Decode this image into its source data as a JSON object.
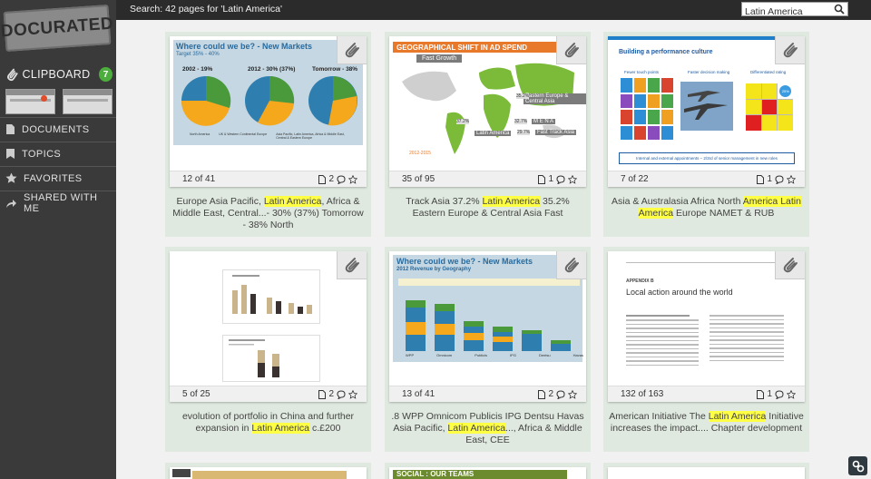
{
  "app": {
    "logo_text": "DOCURATED"
  },
  "sidebar": {
    "clipboard_label": "CLIPBOARD",
    "clipboard_count": "7",
    "items": [
      {
        "label": "DOCUMENTS",
        "icon": "documents-icon"
      },
      {
        "label": "TOPICS",
        "icon": "topics-icon"
      },
      {
        "label": "FAVORITES",
        "icon": "star-icon"
      },
      {
        "label": "SHARED WITH ME",
        "icon": "share-icon"
      }
    ]
  },
  "header": {
    "search_summary": "Search: 42 pages for 'Latin America'",
    "search_value": "Latin America"
  },
  "results": [
    {
      "page": "12 of 41",
      "pages_count": "2",
      "comments": "",
      "caption_parts": [
        "Europe Asia Pacific, ",
        "Latin America",
        ", Africa & Middle East, Central...- 30% (37%) Tomorrow - 38% North"
      ],
      "thumb": {
        "title": "Where could we be? - New Markets",
        "subtitle": "Target 35% - 40%",
        "labels": [
          "2002 - 19%",
          "2012 - 30% (37%)",
          "Tomorrow - 38%"
        ],
        "legend": [
          "North America",
          "UK & Western Continental Europe",
          "Asia Pacific, Latin America, Africa & Middle East, Central & Eastern Europe"
        ]
      }
    },
    {
      "page": "35 of 95",
      "pages_count": "1",
      "comments": "",
      "caption_parts": [
        "Track Asia 37.2% ",
        "Latin America",
        " 35.2% Eastern Europe & Central Asia Fast"
      ],
      "thumb": {
        "title": "GEOGRAPHICAL SHIFT IN AD SPEND",
        "tag": "Fast Growth",
        "labels": [
          "Latin America",
          "Eastern Europe & Central Asia",
          "M E N A",
          "Fast Track Asia"
        ],
        "values": [
          "37.2%",
          "35.2%",
          "32.7%",
          "29.7%"
        ],
        "footer": "2012-2015"
      }
    },
    {
      "page": "7 of 22",
      "pages_count": "1",
      "comments": "",
      "caption_parts": [
        "Asia & Australasia Africa North ",
        "America Latin America",
        " Europe NAMET & RUB"
      ],
      "thumb": {
        "title": "Building a performance culture",
        "cols": [
          "Fewer touch points",
          "Faster decision making",
          "Differentiated rating"
        ],
        "footer": "Internal and external appointments – 2/3rd of senior management in new roles",
        "pct": "25%"
      }
    },
    {
      "page": "5 of 25",
      "pages_count": "2",
      "comments": "",
      "caption_parts": [
        "evolution of portfolio in China and further expansion in ",
        "Latin America",
        " c.£200"
      ],
      "thumb": {}
    },
    {
      "page": "13 of 41",
      "pages_count": "2",
      "comments": "",
      "caption_parts": [
        ".8 WPP Omnicom Publicis IPG Dentsu Havas Asia Pacific, ",
        "Latin America",
        "..., Africa & Middle East, CEE"
      ],
      "thumb": {
        "title": "Where could we be? - New Markets",
        "subtitle": "2012 Revenue by Geography",
        "bars": [
          "WPP",
          "Omnicom",
          "Publicis",
          "IPG",
          "Dentsu",
          "Havas"
        ]
      }
    },
    {
      "page": "132 of 163",
      "pages_count": "1",
      "comments": "",
      "caption_parts": [
        "American Initiative The ",
        "Latin America",
        " Initiative increases the impact.... Chapter development"
      ],
      "thumb": {
        "appendix": "APPENDIX B",
        "title": "Local action around the world"
      }
    }
  ],
  "bottom_row": [
    {
      "label": "SOCIAL : OUR TEAMS"
    }
  ]
}
